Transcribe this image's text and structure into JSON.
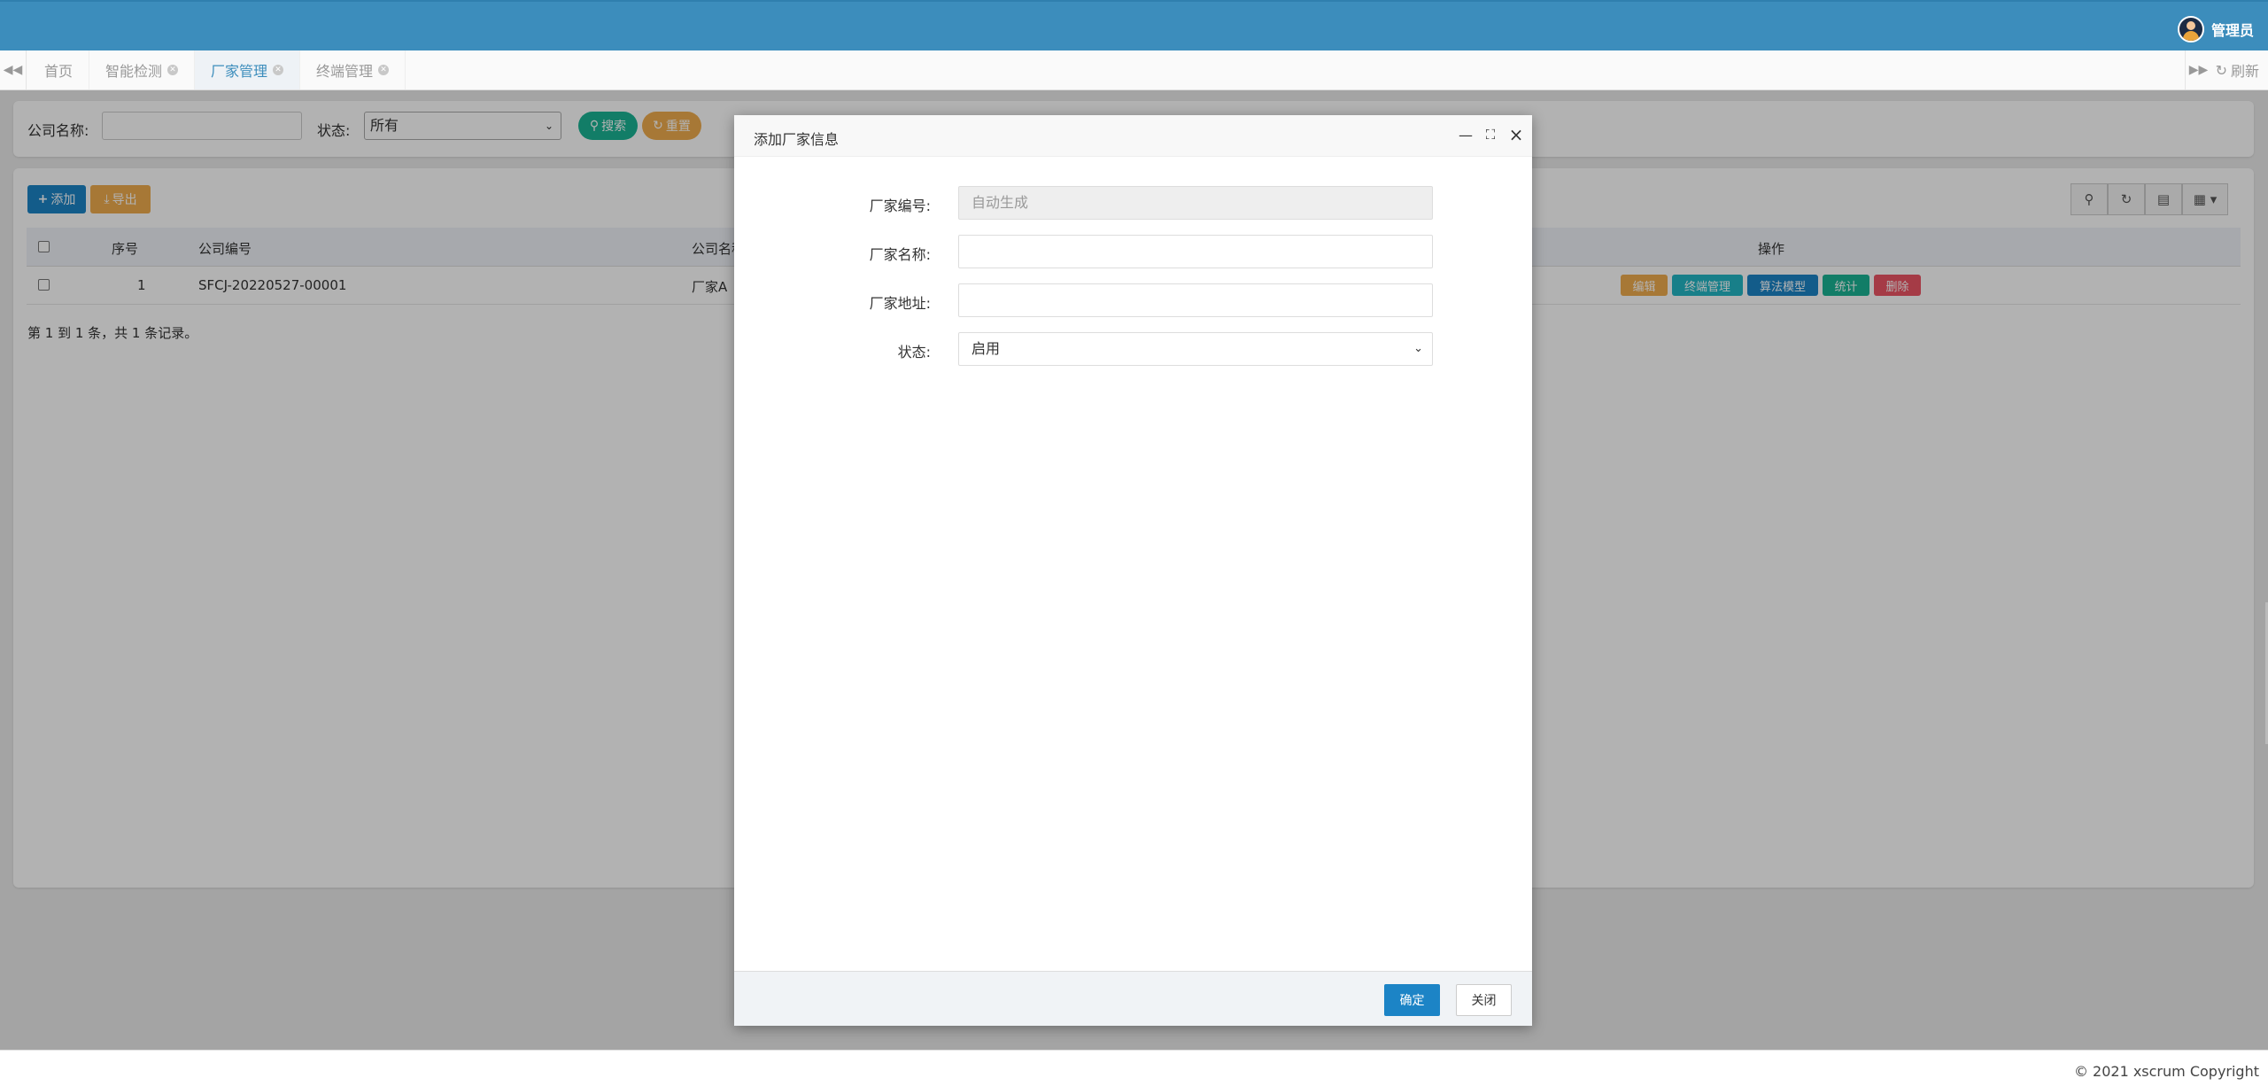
{
  "header": {
    "user_name": "管理员"
  },
  "tabs": {
    "items": [
      {
        "label": "首页",
        "closable": false
      },
      {
        "label": "智能检测",
        "closable": true
      },
      {
        "label": "厂家管理",
        "closable": true,
        "active": true
      },
      {
        "label": "终端管理",
        "closable": true
      }
    ],
    "refresh_label": "刷新"
  },
  "search": {
    "company_label": "公司名称:",
    "company_value": "",
    "status_label": "状态:",
    "status_value": "所有",
    "search_button": "搜索",
    "reset_button": "重置"
  },
  "toolbar": {
    "add_button": "添加",
    "export_button": "导出"
  },
  "table": {
    "columns": [
      "序号",
      "公司编号",
      "公司名称",
      "操作"
    ],
    "rows": [
      {
        "index": "1",
        "code": "SFCJ-20220527-00001",
        "name": "厂家A"
      }
    ],
    "actions": [
      {
        "label": "编辑",
        "color": "#f0ad4e"
      },
      {
        "label": "终端管理",
        "color": "#23b7c5"
      },
      {
        "label": "算法模型",
        "color": "#1c84c6"
      },
      {
        "label": "统计",
        "color": "#1ab394"
      },
      {
        "label": "删除",
        "color": "#ed5565"
      }
    ],
    "pagination_text": "第 1 到 1 条，共 1 条记录。"
  },
  "modal": {
    "title": "添加厂家信息",
    "fields": [
      {
        "label": "厂家编号:",
        "value": "",
        "placeholder": "自动生成",
        "disabled": true
      },
      {
        "label": "厂家名称:",
        "value": "",
        "placeholder": "",
        "disabled": false
      },
      {
        "label": "厂家地址:",
        "value": "",
        "placeholder": "",
        "disabled": false
      },
      {
        "label": "状态:",
        "value": "启用",
        "type": "select"
      }
    ],
    "confirm_button": "确定",
    "close_button": "关闭"
  },
  "footer": {
    "copyright": "© 2021 xscrum Copyright"
  },
  "colors": {
    "topbar": "#3c8dbc",
    "primary": "#1c84c6",
    "warning": "#f0ad4e",
    "success": "#1ab394",
    "danger": "#ed5565",
    "info": "#23b7c5"
  },
  "icons": [
    "backward-icon",
    "forward-icon",
    "refresh-icon",
    "search-icon",
    "reset-icon",
    "plus-icon",
    "download-icon",
    "minimize-icon",
    "maximize-icon",
    "close-icon",
    "columns-icon",
    "toggle-view-icon"
  ]
}
